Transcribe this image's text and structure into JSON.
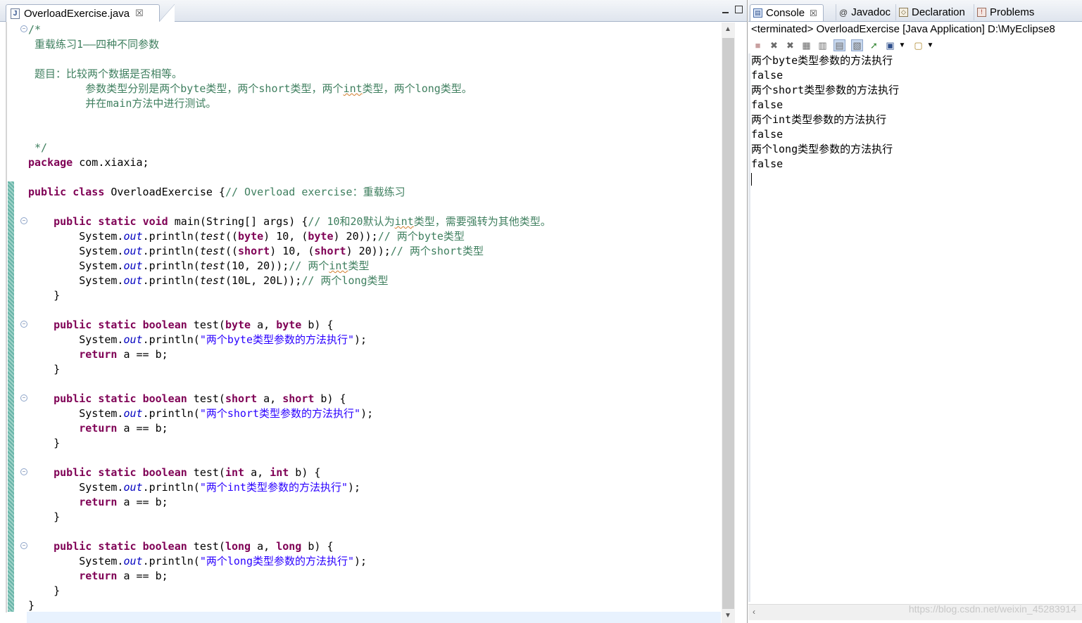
{
  "editor": {
    "tab_title": "OverloadExercise.java",
    "tab_close": "☒",
    "lines": [
      [
        {
          "t": "/*",
          "c": "cm"
        }
      ],
      [
        {
          "t": " 重载练习1——四种不同参数",
          "c": "cm"
        }
      ],
      [],
      [
        {
          "t": " 题目：比较两个数据是否相等。",
          "c": "cm"
        }
      ],
      [
        {
          "t": "         参数类型分别是两个byte类型，两个short类型，两个",
          "c": "cm"
        },
        {
          "t": "int",
          "c": "cm sq"
        },
        {
          "t": "类型，两个long类型。",
          "c": "cm"
        }
      ],
      [
        {
          "t": "         并在main方法中进行测试。",
          "c": "cm"
        }
      ],
      [],
      [],
      [
        {
          "t": " */",
          "c": "cm"
        }
      ],
      [
        {
          "t": "package",
          "c": "kw"
        },
        {
          "t": " com.xiaxia;",
          "c": ""
        }
      ],
      [],
      [
        {
          "t": "public",
          "c": "kw"
        },
        {
          "t": " ",
          "c": ""
        },
        {
          "t": "class",
          "c": "kw"
        },
        {
          "t": " OverloadExercise {",
          "c": ""
        },
        {
          "t": "// Overload exercise：重载练习",
          "c": "cm"
        }
      ],
      [],
      [
        {
          "t": "    ",
          "c": ""
        },
        {
          "t": "public",
          "c": "kw"
        },
        {
          "t": " ",
          "c": ""
        },
        {
          "t": "static",
          "c": "kw"
        },
        {
          "t": " ",
          "c": ""
        },
        {
          "t": "void",
          "c": "kw"
        },
        {
          "t": " main(String[] args) {",
          "c": ""
        },
        {
          "t": "// 10和20默认为",
          "c": "cm"
        },
        {
          "t": "int",
          "c": "cm sq"
        },
        {
          "t": "类型，需要强转为其他类型。",
          "c": "cm"
        }
      ],
      [
        {
          "t": "        System.",
          "c": ""
        },
        {
          "t": "out",
          "c": "fld"
        },
        {
          "t": ".println(",
          "c": ""
        },
        {
          "t": "test",
          "c": "it"
        },
        {
          "t": "((",
          "c": ""
        },
        {
          "t": "byte",
          "c": "kw"
        },
        {
          "t": ") 10, (",
          "c": ""
        },
        {
          "t": "byte",
          "c": "kw"
        },
        {
          "t": ") 20));",
          "c": ""
        },
        {
          "t": "// 两个byte类型",
          "c": "cm"
        }
      ],
      [
        {
          "t": "        System.",
          "c": ""
        },
        {
          "t": "out",
          "c": "fld"
        },
        {
          "t": ".println(",
          "c": ""
        },
        {
          "t": "test",
          "c": "it"
        },
        {
          "t": "((",
          "c": ""
        },
        {
          "t": "short",
          "c": "kw"
        },
        {
          "t": ") 10, (",
          "c": ""
        },
        {
          "t": "short",
          "c": "kw"
        },
        {
          "t": ") 20));",
          "c": ""
        },
        {
          "t": "// 两个short类型",
          "c": "cm"
        }
      ],
      [
        {
          "t": "        System.",
          "c": ""
        },
        {
          "t": "out",
          "c": "fld"
        },
        {
          "t": ".println(",
          "c": ""
        },
        {
          "t": "test",
          "c": "it"
        },
        {
          "t": "(10, 20));",
          "c": ""
        },
        {
          "t": "// 两个",
          "c": "cm"
        },
        {
          "t": "int",
          "c": "cm sq"
        },
        {
          "t": "类型",
          "c": "cm"
        }
      ],
      [
        {
          "t": "        System.",
          "c": ""
        },
        {
          "t": "out",
          "c": "fld"
        },
        {
          "t": ".println(",
          "c": ""
        },
        {
          "t": "test",
          "c": "it"
        },
        {
          "t": "(10L, 20L));",
          "c": ""
        },
        {
          "t": "// 两个long类型",
          "c": "cm"
        }
      ],
      [
        {
          "t": "    }",
          "c": ""
        }
      ],
      [],
      [
        {
          "t": "    ",
          "c": ""
        },
        {
          "t": "public",
          "c": "kw"
        },
        {
          "t": " ",
          "c": ""
        },
        {
          "t": "static",
          "c": "kw"
        },
        {
          "t": " ",
          "c": ""
        },
        {
          "t": "boolean",
          "c": "kw"
        },
        {
          "t": " test(",
          "c": ""
        },
        {
          "t": "byte",
          "c": "kw"
        },
        {
          "t": " a, ",
          "c": ""
        },
        {
          "t": "byte",
          "c": "kw"
        },
        {
          "t": " b) {",
          "c": ""
        }
      ],
      [
        {
          "t": "        System.",
          "c": ""
        },
        {
          "t": "out",
          "c": "fld"
        },
        {
          "t": ".println(",
          "c": ""
        },
        {
          "t": "\"两个byte类型参数的方法执行\"",
          "c": "st"
        },
        {
          "t": ");",
          "c": ""
        }
      ],
      [
        {
          "t": "        ",
          "c": ""
        },
        {
          "t": "return",
          "c": "kw"
        },
        {
          "t": " a == b;",
          "c": ""
        }
      ],
      [
        {
          "t": "    }",
          "c": ""
        }
      ],
      [],
      [
        {
          "t": "    ",
          "c": ""
        },
        {
          "t": "public",
          "c": "kw"
        },
        {
          "t": " ",
          "c": ""
        },
        {
          "t": "static",
          "c": "kw"
        },
        {
          "t": " ",
          "c": ""
        },
        {
          "t": "boolean",
          "c": "kw"
        },
        {
          "t": " test(",
          "c": ""
        },
        {
          "t": "short",
          "c": "kw"
        },
        {
          "t": " a, ",
          "c": ""
        },
        {
          "t": "short",
          "c": "kw"
        },
        {
          "t": " b) {",
          "c": ""
        }
      ],
      [
        {
          "t": "        System.",
          "c": ""
        },
        {
          "t": "out",
          "c": "fld"
        },
        {
          "t": ".println(",
          "c": ""
        },
        {
          "t": "\"两个short类型参数的方法执行\"",
          "c": "st"
        },
        {
          "t": ");",
          "c": ""
        }
      ],
      [
        {
          "t": "        ",
          "c": ""
        },
        {
          "t": "return",
          "c": "kw"
        },
        {
          "t": " a == b;",
          "c": ""
        }
      ],
      [
        {
          "t": "    }",
          "c": ""
        }
      ],
      [],
      [
        {
          "t": "    ",
          "c": ""
        },
        {
          "t": "public",
          "c": "kw"
        },
        {
          "t": " ",
          "c": ""
        },
        {
          "t": "static",
          "c": "kw"
        },
        {
          "t": " ",
          "c": ""
        },
        {
          "t": "boolean",
          "c": "kw"
        },
        {
          "t": " test(",
          "c": ""
        },
        {
          "t": "int",
          "c": "kw"
        },
        {
          "t": " a, ",
          "c": ""
        },
        {
          "t": "int",
          "c": "kw"
        },
        {
          "t": " b) {",
          "c": ""
        }
      ],
      [
        {
          "t": "        System.",
          "c": ""
        },
        {
          "t": "out",
          "c": "fld"
        },
        {
          "t": ".println(",
          "c": ""
        },
        {
          "t": "\"两个int类型参数的方法执行\"",
          "c": "st"
        },
        {
          "t": ");",
          "c": ""
        }
      ],
      [
        {
          "t": "        ",
          "c": ""
        },
        {
          "t": "return",
          "c": "kw"
        },
        {
          "t": " a == b;",
          "c": ""
        }
      ],
      [
        {
          "t": "    }",
          "c": ""
        }
      ],
      [],
      [
        {
          "t": "    ",
          "c": ""
        },
        {
          "t": "public",
          "c": "kw"
        },
        {
          "t": " ",
          "c": ""
        },
        {
          "t": "static",
          "c": "kw"
        },
        {
          "t": " ",
          "c": ""
        },
        {
          "t": "boolean",
          "c": "kw"
        },
        {
          "t": " test(",
          "c": ""
        },
        {
          "t": "long",
          "c": "kw"
        },
        {
          "t": " a, ",
          "c": ""
        },
        {
          "t": "long",
          "c": "kw"
        },
        {
          "t": " b) {",
          "c": ""
        }
      ],
      [
        {
          "t": "        System.",
          "c": ""
        },
        {
          "t": "out",
          "c": "fld"
        },
        {
          "t": ".println(",
          "c": ""
        },
        {
          "t": "\"两个long类型参数的方法执行\"",
          "c": "st"
        },
        {
          "t": ");",
          "c": ""
        }
      ],
      [
        {
          "t": "        ",
          "c": ""
        },
        {
          "t": "return",
          "c": "kw"
        },
        {
          "t": " a == b;",
          "c": ""
        }
      ],
      [
        {
          "t": "    }",
          "c": ""
        }
      ],
      [
        {
          "t": "}",
          "c": ""
        }
      ]
    ],
    "fold_lines": [
      0,
      13,
      20,
      25,
      30,
      35
    ]
  },
  "console": {
    "tabs": [
      {
        "label": "Console",
        "icon": "console-icon",
        "active": true
      },
      {
        "label": "Javadoc",
        "icon": "javadoc-icon",
        "active": false
      },
      {
        "label": "Declaration",
        "icon": "declaration-icon",
        "active": false
      },
      {
        "label": "Problems",
        "icon": "problems-icon",
        "active": false
      }
    ],
    "close_glyph": "☒",
    "header": "<terminated> OverloadExercise [Java Application] D:\\MyEclipse8",
    "output": [
      "两个byte类型参数的方法执行",
      "false",
      "两个short类型参数的方法执行",
      "false",
      "两个int类型参数的方法执行",
      "false",
      "两个long类型参数的方法执行",
      "false"
    ],
    "watermark": "https://blog.csdn.net/weixin_45283914"
  },
  "colors": {
    "keyword": "#7f0055",
    "comment": "#3f7f5f",
    "string": "#2a00ff",
    "field": "#0000c0"
  }
}
